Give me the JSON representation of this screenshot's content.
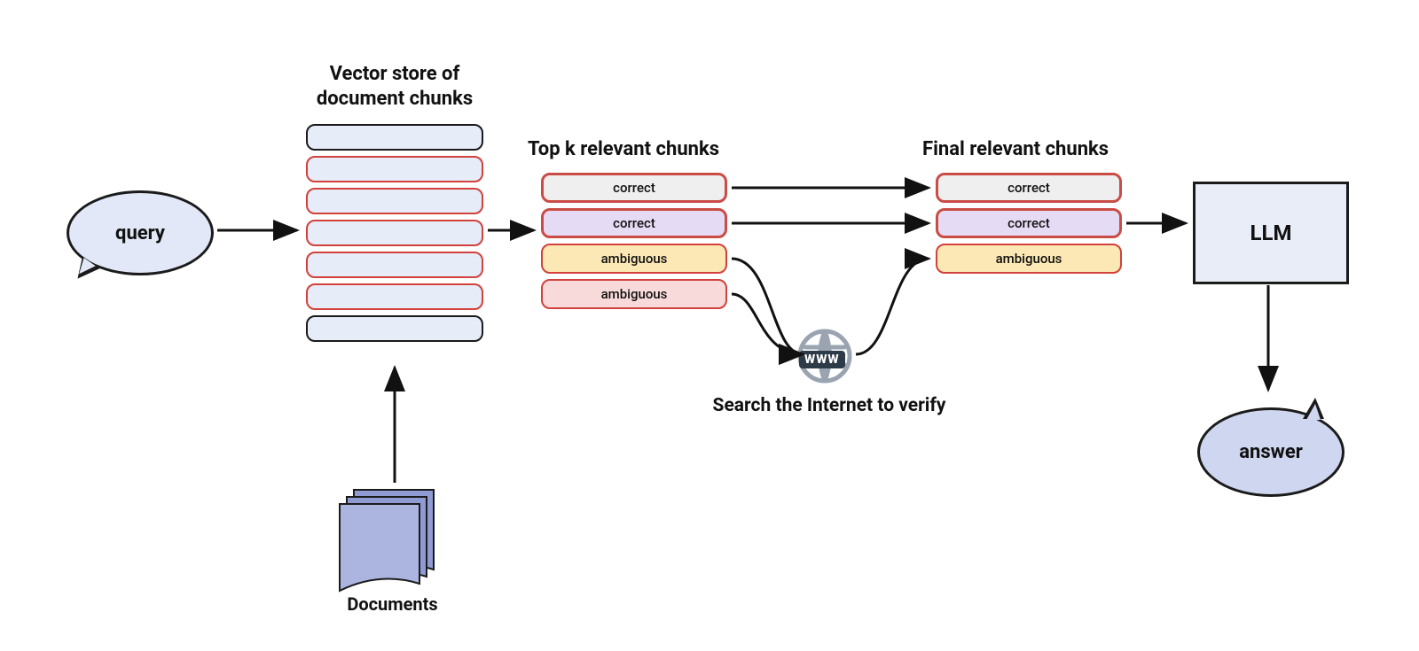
{
  "nodes": {
    "query": "query",
    "vector_store_heading": "Vector store of\ndocument chunks",
    "documents_label": "Documents",
    "top_k_heading": "Top k relevant chunks",
    "final_heading": "Final relevant chunks",
    "llm_label": "LLM",
    "answer": "answer",
    "www_label": "WWW",
    "search_caption": "Search the Internet to verify"
  },
  "top_k_chunks": [
    {
      "text": "correct",
      "kind": "correct-grey"
    },
    {
      "text": "correct",
      "kind": "correct-purple"
    },
    {
      "text": "ambiguous",
      "kind": "ambiguous"
    },
    {
      "text": "ambiguous",
      "kind": "ambiguous-pink"
    }
  ],
  "final_chunks": [
    {
      "text": "correct",
      "kind": "correct-grey"
    },
    {
      "text": "correct",
      "kind": "correct-purple"
    },
    {
      "text": "ambiguous",
      "kind": "ambiguous"
    }
  ],
  "vector_store_chunks": [
    "light-blue",
    "light-red",
    "light-red",
    "light-red",
    "light-red",
    "light-red",
    "light-blue"
  ]
}
